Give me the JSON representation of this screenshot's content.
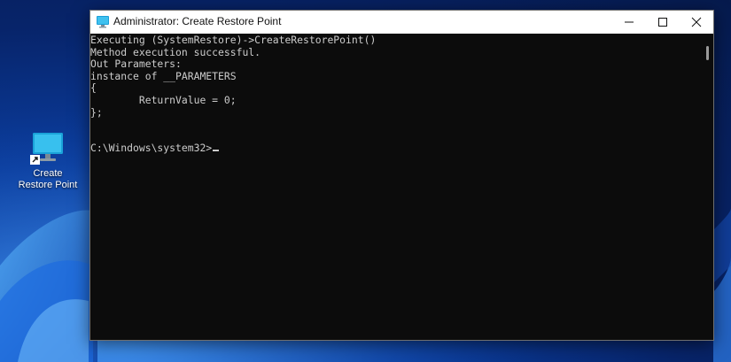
{
  "desktop": {
    "shortcut_label_line1": "Create",
    "shortcut_label_line2": "Restore Point"
  },
  "window": {
    "title": "Administrator: Create Restore Point",
    "minimize_glyph": "—",
    "maximize_glyph": "☐",
    "close_glyph": "✕"
  },
  "console": {
    "lines": [
      "Executing (SystemRestore)->CreateRestorePoint()",
      "Method execution successful.",
      "Out Parameters:",
      "instance of __PARAMETERS",
      "{",
      "        ReturnValue = 0;",
      "};",
      "",
      ""
    ],
    "prompt": "C:\\Windows\\system32>"
  },
  "colors": {
    "console_bg": "#0c0c0c",
    "console_fg": "#cccccc",
    "titlebar_bg": "#ffffff",
    "wallpaper_primary": "#0b3d9e",
    "wallpaper_accent": "#2a6fd6"
  },
  "icons": {
    "app": "terminal-monitor-icon",
    "desktop_shortcut": "monitor-shortcut-icon"
  }
}
